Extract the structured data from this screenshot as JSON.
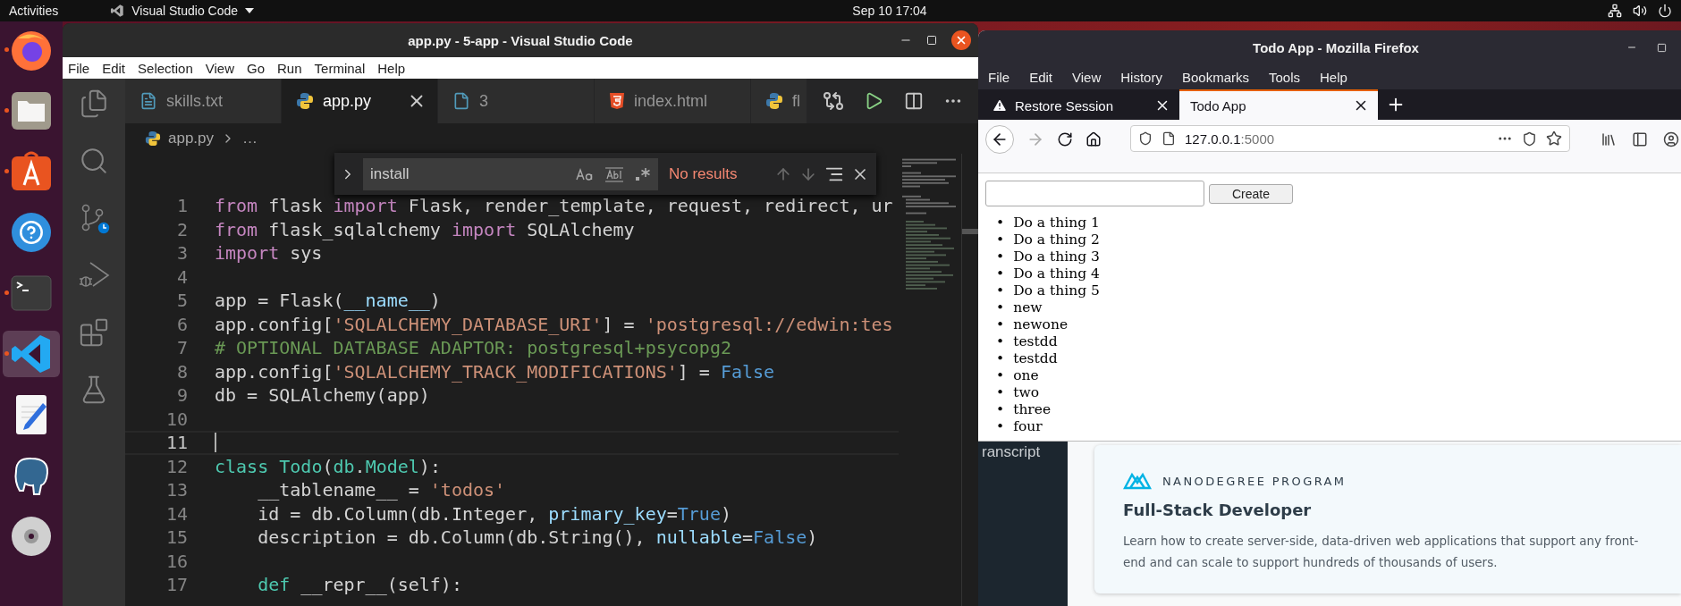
{
  "top_bar": {
    "activities": "Activities",
    "app_menu": "Visual Studio Code",
    "clock": "Sep 10  17:04"
  },
  "dock": {
    "items": [
      {
        "kind": "firefox",
        "running": true,
        "selected": false
      },
      {
        "kind": "files",
        "running": true,
        "selected": false
      },
      {
        "kind": "software",
        "running": true,
        "selected": false
      },
      {
        "kind": "help",
        "running": false,
        "selected": false
      },
      {
        "kind": "terminal",
        "running": true,
        "selected": false
      },
      {
        "kind": "vscode",
        "running": true,
        "selected": true
      },
      {
        "kind": "editor",
        "running": false,
        "selected": false
      },
      {
        "kind": "postgres",
        "running": false,
        "selected": false
      },
      {
        "kind": "disc",
        "running": false,
        "selected": false
      }
    ]
  },
  "vscode": {
    "title": "app.py - 5-app - Visual Studio Code",
    "menu": [
      "File",
      "Edit",
      "Selection",
      "View",
      "Go",
      "Run",
      "Terminal",
      "Help"
    ],
    "activity_bar": [
      {
        "kind": "explorer"
      },
      {
        "kind": "search"
      },
      {
        "kind": "source_control"
      },
      {
        "kind": "debug"
      },
      {
        "kind": "extensions"
      },
      {
        "kind": "testing"
      }
    ],
    "tabs": [
      {
        "label": "skills.txt",
        "kind": "text",
        "selected": false
      },
      {
        "label": "app.py",
        "kind": "python",
        "selected": true
      },
      {
        "label": "3",
        "kind": "file",
        "selected": false
      },
      {
        "label": "index.html",
        "kind": "html",
        "selected": false
      },
      {
        "label": "fl",
        "kind": "python",
        "selected": false
      }
    ],
    "breadcrumb": {
      "file": "app.py",
      "rest": "…"
    },
    "find": {
      "value": "install",
      "result": "No results"
    },
    "lines": [
      {
        "number": "1",
        "current": false,
        "tokens": [
          {
            "kind": "import",
            "text": "from"
          },
          {
            "kind": "plain",
            "text": " flask "
          },
          {
            "kind": "import",
            "text": "import"
          },
          {
            "kind": "plain",
            "text": " Flask, render_template, request, redirect, ur"
          }
        ]
      },
      {
        "number": "2",
        "current": false,
        "tokens": [
          {
            "kind": "import",
            "text": "from"
          },
          {
            "kind": "plain",
            "text": " flask_sqlalchemy "
          },
          {
            "kind": "import",
            "text": "import"
          },
          {
            "kind": "plain",
            "text": " SQLAlchemy"
          }
        ]
      },
      {
        "number": "3",
        "current": false,
        "tokens": [
          {
            "kind": "import",
            "text": "import"
          },
          {
            "kind": "plain",
            "text": " sys"
          }
        ]
      },
      {
        "number": "4",
        "current": false
      },
      {
        "number": "5",
        "current": false,
        "tokens": [
          {
            "kind": "plain",
            "text": "app = Flask("
          },
          {
            "kind": "variable",
            "text": "__name__"
          },
          {
            "kind": "plain",
            "text": ")"
          }
        ]
      },
      {
        "number": "6",
        "current": false,
        "tokens": [
          {
            "kind": "plain",
            "text": "app.config["
          },
          {
            "kind": "string",
            "text": "'SQLALCHEMY_DATABASE_URI'"
          },
          {
            "kind": "plain",
            "text": "] = "
          },
          {
            "kind": "string",
            "text": "'postgresql://edwin:tes"
          }
        ]
      },
      {
        "number": "7",
        "current": false,
        "tokens": [
          {
            "kind": "comment",
            "text": "# OPTIONAL DATABASE ADAPTOR: postgresql+psycopg2"
          }
        ]
      },
      {
        "number": "8",
        "current": false,
        "tokens": [
          {
            "kind": "plain",
            "text": "app.config["
          },
          {
            "kind": "string",
            "text": "'SQLALCHEMY_TRACK_MODIFICATIONS'"
          },
          {
            "kind": "plain",
            "text": "] = "
          },
          {
            "kind": "constant",
            "text": "False"
          }
        ]
      },
      {
        "number": "9",
        "current": false,
        "tokens": [
          {
            "kind": "plain",
            "text": "db = SQLAlchemy(app)"
          }
        ]
      },
      {
        "number": "10",
        "current": false
      },
      {
        "number": "11",
        "current": true
      },
      {
        "number": "12",
        "current": false,
        "tokens": [
          {
            "kind": "storage",
            "text": "class"
          },
          {
            "kind": "type",
            "text": " Todo"
          },
          {
            "kind": "plain",
            "text": "("
          },
          {
            "kind": "type",
            "text": "db"
          },
          {
            "kind": "plain",
            "text": "."
          },
          {
            "kind": "type",
            "text": "Model"
          },
          {
            "kind": "plain",
            "text": "):"
          }
        ]
      },
      {
        "number": "13",
        "current": false,
        "tokens": [
          {
            "kind": "plain",
            "text": "    __tablename__ = "
          },
          {
            "kind": "string",
            "text": "'todos'"
          }
        ]
      },
      {
        "number": "14",
        "current": false,
        "tokens": [
          {
            "kind": "plain",
            "text": "    id = db.Column(db.Integer, "
          },
          {
            "kind": "variable",
            "text": "primary_key"
          },
          {
            "kind": "plain",
            "text": "="
          },
          {
            "kind": "constant",
            "text": "True"
          },
          {
            "kind": "plain",
            "text": ")"
          }
        ]
      },
      {
        "number": "15",
        "current": false,
        "tokens": [
          {
            "kind": "plain",
            "text": "    description = db.Column(db.String(), "
          },
          {
            "kind": "variable",
            "text": "nullable"
          },
          {
            "kind": "plain",
            "text": "="
          },
          {
            "kind": "constant",
            "text": "False"
          },
          {
            "kind": "plain",
            "text": ")"
          }
        ]
      },
      {
        "number": "16",
        "current": false
      },
      {
        "number": "17",
        "current": false,
        "tokens": [
          {
            "kind": "storage",
            "text": "    def"
          },
          {
            "kind": "plain",
            "text": " __repr__(self):"
          }
        ]
      }
    ]
  },
  "firefox": {
    "title": "Todo App - Mozilla Firefox",
    "menu": [
      "File",
      "Edit",
      "View",
      "History",
      "Bookmarks",
      "Tools",
      "Help"
    ],
    "tabs": [
      {
        "label": "Restore Session",
        "kind": "warning",
        "selected": false
      },
      {
        "label": "Todo App",
        "kind": "page",
        "selected": true
      }
    ],
    "url": {
      "host": "127.0.0.1",
      "port": ":5000"
    },
    "page": {
      "button": "Create",
      "items": [
        {
          "bullet": "•",
          "text": "Do a thing 1"
        },
        {
          "bullet": "•",
          "text": "Do a thing 2"
        },
        {
          "bullet": "•",
          "text": "Do a thing 3"
        },
        {
          "bullet": "•",
          "text": "Do a thing 4"
        },
        {
          "bullet": "•",
          "text": "Do a thing 5"
        },
        {
          "bullet": "•",
          "text": "new"
        },
        {
          "bullet": "•",
          "text": "newone"
        },
        {
          "bullet": "•",
          "text": "testdd"
        },
        {
          "bullet": "•",
          "text": "testdd"
        },
        {
          "bullet": "•",
          "text": "one"
        },
        {
          "bullet": "•",
          "text": "two"
        },
        {
          "bullet": "•",
          "text": "three"
        },
        {
          "bullet": "•",
          "text": "four"
        }
      ]
    }
  },
  "background_page": {
    "sidebar_text": "ranscript",
    "eyebrow": "NANODEGREE PROGRAM",
    "title": "Full-Stack Developer",
    "description": "Learn how to create server-side, data-driven web applications that support any front-end and can scale to support hundreds of thousands of users."
  }
}
